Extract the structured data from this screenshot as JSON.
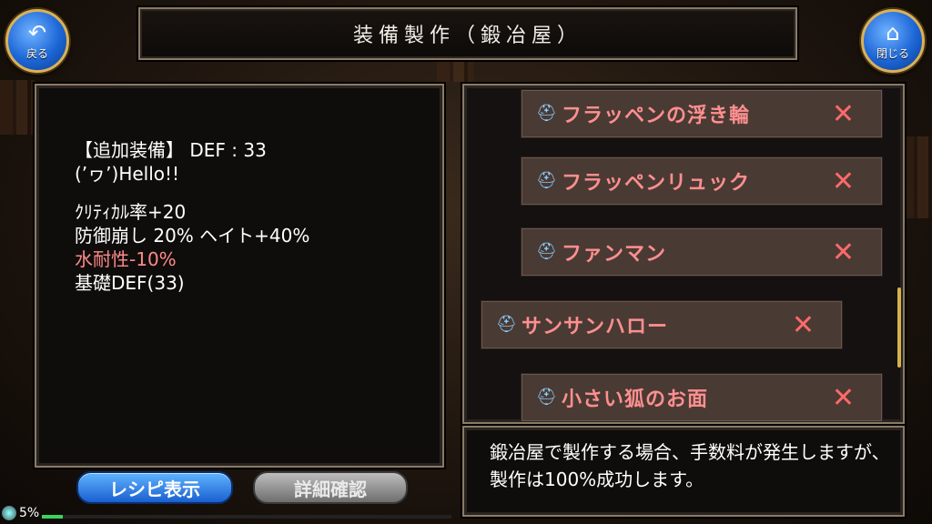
{
  "header": {
    "title": "装備製作（鍛冶屋）"
  },
  "nav": {
    "back_label": "戻る",
    "close_label": "閉じる"
  },
  "detail": {
    "line1": "【追加装備】 DEF : 33",
    "line2": "(’ヮ’)Hello!!",
    "stat1": "ｸﾘﾃｨｶﾙ率+20",
    "stat2": "防御崩し 20% ヘイト+40%",
    "stat3": "水耐性-10%",
    "stat4": "基礎DEF(33)"
  },
  "items": [
    {
      "name": "フラッペンの浮き輪",
      "mark": "✕"
    },
    {
      "name": "フラッペンリュック",
      "mark": "✕"
    },
    {
      "name": "ファンマン",
      "mark": "✕"
    },
    {
      "name": "サンサンハロー",
      "mark": "✕"
    },
    {
      "name": "小さい狐のお面",
      "mark": "✕"
    }
  ],
  "info": {
    "text": "鍛冶屋で製作する場合、手数料が発生しますが、製作は100%成功します。"
  },
  "buttons": {
    "recipe": "レシピ表示",
    "detail": "詳細確認"
  },
  "status": {
    "percent_label": "5%",
    "progress": 0.05
  },
  "colors": {
    "accent_blue": "#1c66d6",
    "item_text": "#ff8f8f",
    "gold": "#d9b25a"
  }
}
